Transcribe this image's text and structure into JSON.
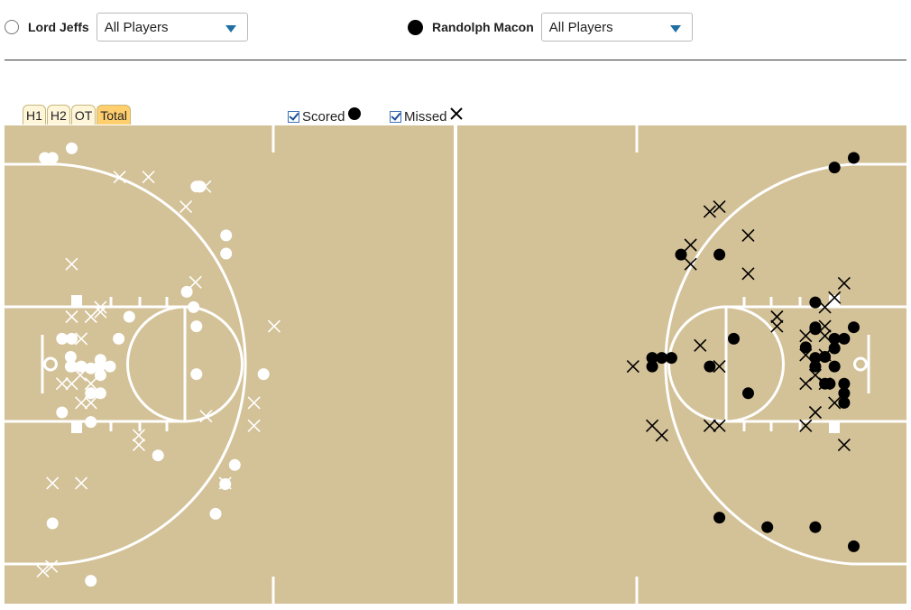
{
  "teams": [
    {
      "name": "Lord Jeffs",
      "selection": "All Players",
      "marker": "hollow-circle"
    },
    {
      "name": "Randolph Macon",
      "selection": "All Players",
      "marker": "filled-circle"
    }
  ],
  "tabs": [
    {
      "label": "H1",
      "active": false
    },
    {
      "label": "H2",
      "active": false
    },
    {
      "label": "OT",
      "active": false
    },
    {
      "label": "Total",
      "active": true
    }
  ],
  "legend": {
    "scored": {
      "label": "Scored",
      "checked": true
    },
    "missed": {
      "label": "Missed",
      "checked": true
    }
  },
  "colors": {
    "court": "#d3c197",
    "lines": "#ffffff",
    "team_a_marks": "#ffffff",
    "team_b_marks": "#000000",
    "active_tab": "#ffcf6e",
    "tab": "#fff6da",
    "dropdown_caret": "#1f6fa5"
  },
  "chart_data": {
    "type": "scatter",
    "title": "",
    "axes": "court coordinates in feet (x: 0-94 baseline to baseline, y: 0-50 sideline to sideline)",
    "series": [
      {
        "name": "Lord Jeffs",
        "scored": [
          [
            4.2,
            3.4
          ],
          [
            5.0,
            3.4
          ],
          [
            7.0,
            2.4
          ],
          [
            20.0,
            6.4
          ],
          [
            20.4,
            6.4
          ],
          [
            23.1,
            11.5
          ],
          [
            23.1,
            13.4
          ],
          [
            19.0,
            17.4
          ],
          [
            19.7,
            19.0
          ],
          [
            13.0,
            20.0
          ],
          [
            11.9,
            22.3
          ],
          [
            20.0,
            21.0
          ],
          [
            6.0,
            22.3
          ],
          [
            7.0,
            22.3
          ],
          [
            6.9,
            24.2
          ],
          [
            7.0,
            25.2
          ],
          [
            8.0,
            25.2
          ],
          [
            9.0,
            25.4
          ],
          [
            9.9,
            25.2
          ],
          [
            10.0,
            24.5
          ],
          [
            11.0,
            25.2
          ],
          [
            10.0,
            26.1
          ],
          [
            6.9,
            25.2
          ],
          [
            9.0,
            28.0
          ],
          [
            10.0,
            28.0
          ],
          [
            6.0,
            30.0
          ],
          [
            9.0,
            31.0
          ],
          [
            20.0,
            26.0
          ],
          [
            27.0,
            26.0
          ],
          [
            16.0,
            34.5
          ],
          [
            24.0,
            35.5
          ],
          [
            23.0,
            37.5
          ],
          [
            5.0,
            41.6
          ],
          [
            22.0,
            40.6
          ],
          [
            9.0,
            47.6
          ]
        ],
        "missed": [
          [
            12.0,
            5.4
          ],
          [
            15.0,
            5.4
          ],
          [
            20.9,
            6.4
          ],
          [
            18.9,
            8.5
          ],
          [
            7.0,
            14.5
          ],
          [
            19.9,
            16.4
          ],
          [
            10.0,
            19.0
          ],
          [
            7.0,
            20.0
          ],
          [
            9.0,
            20.0
          ],
          [
            10.0,
            19.5
          ],
          [
            28.1,
            21.0
          ],
          [
            8.0,
            22.3
          ],
          [
            7.9,
            26.1
          ],
          [
            6.0,
            27.0
          ],
          [
            7.0,
            27.0
          ],
          [
            9.0,
            27.0
          ],
          [
            8.0,
            29.0
          ],
          [
            9.0,
            29.0
          ],
          [
            26.0,
            29.0
          ],
          [
            21.0,
            30.4
          ],
          [
            26.0,
            31.4
          ],
          [
            14.0,
            32.4
          ],
          [
            14.0,
            33.4
          ],
          [
            5.0,
            37.4
          ],
          [
            8.0,
            37.4
          ],
          [
            23.0,
            37.4
          ],
          [
            4.0,
            46.6
          ],
          [
            4.9,
            46.1
          ]
        ]
      },
      {
        "name": "Randolph Macon",
        "scored": [
          [
            88.5,
            3.4
          ],
          [
            86.5,
            4.4
          ],
          [
            70.5,
            13.5
          ],
          [
            74.5,
            13.5
          ],
          [
            84.5,
            18.5
          ],
          [
            84.5,
            21.1
          ],
          [
            76.0,
            22.3
          ],
          [
            88.5,
            21.1
          ],
          [
            87.5,
            22.3
          ],
          [
            84.5,
            21.3
          ],
          [
            86.5,
            22.3
          ],
          [
            83.5,
            23.2
          ],
          [
            86.5,
            23.3
          ],
          [
            85.5,
            24.2
          ],
          [
            84.5,
            24.3
          ],
          [
            67.5,
            24.3
          ],
          [
            68.5,
            24.3
          ],
          [
            69.5,
            24.3
          ],
          [
            67.5,
            25.2
          ],
          [
            73.5,
            25.2
          ],
          [
            84.5,
            25.2
          ],
          [
            86.5,
            25.2
          ],
          [
            85.5,
            27.0
          ],
          [
            86.0,
            27.0
          ],
          [
            87.5,
            27.0
          ],
          [
            77.5,
            28.0
          ],
          [
            87.5,
            28.0
          ],
          [
            87.5,
            29.0
          ],
          [
            74.5,
            41.0
          ],
          [
            79.5,
            42.0
          ],
          [
            84.5,
            42.0
          ],
          [
            88.5,
            44.0
          ]
        ],
        "missed": [
          [
            74.5,
            8.5
          ],
          [
            73.5,
            9.0
          ],
          [
            71.5,
            12.5
          ],
          [
            77.5,
            11.5
          ],
          [
            71.5,
            14.5
          ],
          [
            77.5,
            15.5
          ],
          [
            87.5,
            16.5
          ],
          [
            86.5,
            18.0
          ],
          [
            85.5,
            19.0
          ],
          [
            80.5,
            20.0
          ],
          [
            80.5,
            21.0
          ],
          [
            85.5,
            21.0
          ],
          [
            83.5,
            22.0
          ],
          [
            85.5,
            22.0
          ],
          [
            72.5,
            23.0
          ],
          [
            83.5,
            24.0
          ],
          [
            85.5,
            24.0
          ],
          [
            65.5,
            25.2
          ],
          [
            74.5,
            25.2
          ],
          [
            84.5,
            26.1
          ],
          [
            83.5,
            27.0
          ],
          [
            85.5,
            27.0
          ],
          [
            86.5,
            29.0
          ],
          [
            84.5,
            30.0
          ],
          [
            67.5,
            31.4
          ],
          [
            68.5,
            32.4
          ],
          [
            73.5,
            31.4
          ],
          [
            74.5,
            31.4
          ],
          [
            83.5,
            31.4
          ],
          [
            87.5,
            33.4
          ]
        ]
      }
    ]
  }
}
